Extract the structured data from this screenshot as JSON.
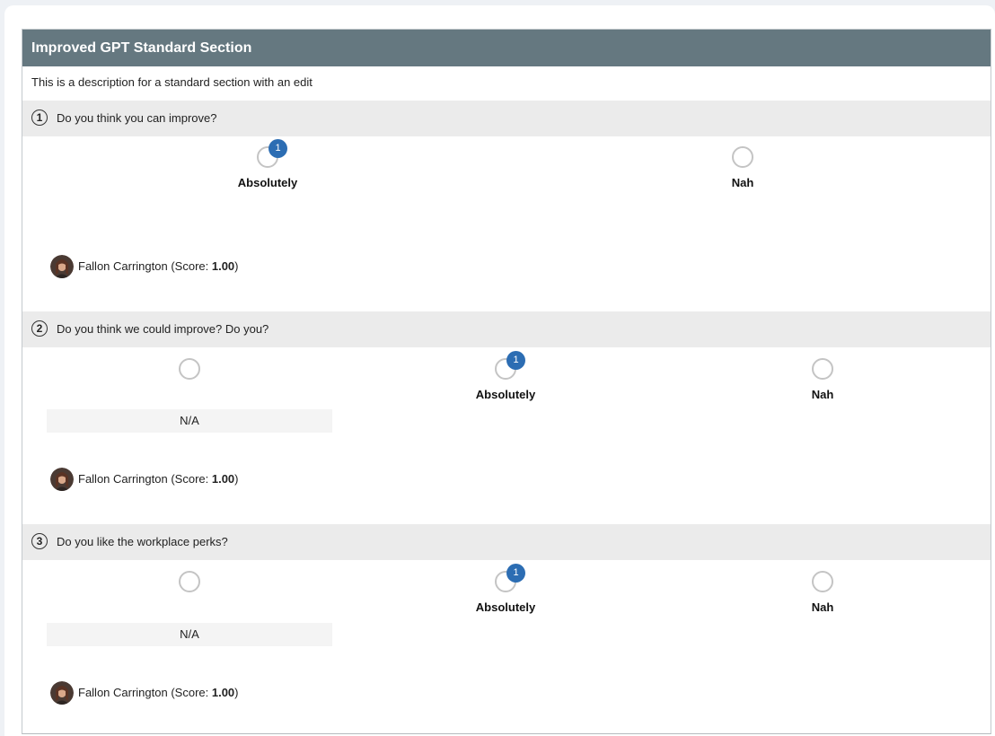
{
  "section": {
    "title": "Improved GPT Standard Section",
    "description": "This is a description for a standard section with an edit"
  },
  "questions": [
    {
      "number": "1",
      "text": "Do you think you can improve?",
      "options": [
        {
          "label": "Absolutely",
          "count": "1",
          "selected": true
        },
        {
          "label": "Nah",
          "count": null,
          "selected": false
        }
      ],
      "respondent": {
        "name": "Fallon Carrington",
        "score_prefix": "(Score: ",
        "score": "1.00",
        "score_suffix": ")"
      }
    },
    {
      "number": "2",
      "text": "Do you think we could improve? Do you?",
      "na_label": "N/A",
      "options": [
        {
          "label": "",
          "count": null,
          "selected": false
        },
        {
          "label": "Absolutely",
          "count": "1",
          "selected": true
        },
        {
          "label": "Nah",
          "count": null,
          "selected": false
        }
      ],
      "respondent": {
        "name": "Fallon Carrington",
        "score_prefix": "(Score: ",
        "score": "1.00",
        "score_suffix": ")"
      }
    },
    {
      "number": "3",
      "text": "Do you like the workplace perks?",
      "na_label": "N/A",
      "options": [
        {
          "label": "",
          "count": null,
          "selected": false
        },
        {
          "label": "Absolutely",
          "count": "1",
          "selected": true
        },
        {
          "label": "Nah",
          "count": null,
          "selected": false
        }
      ],
      "respondent": {
        "name": "Fallon Carrington",
        "score_prefix": "(Score: ",
        "score": "1.00",
        "score_suffix": ")"
      }
    }
  ],
  "colors": {
    "header_bg": "#657880",
    "question_bg": "#ebebeb",
    "badge": "#2c6db3",
    "radio_border": "#c4c4c4"
  },
  "icons": {
    "avatar": "user-avatar-icon",
    "question_number": "numbered-circle-icon"
  }
}
